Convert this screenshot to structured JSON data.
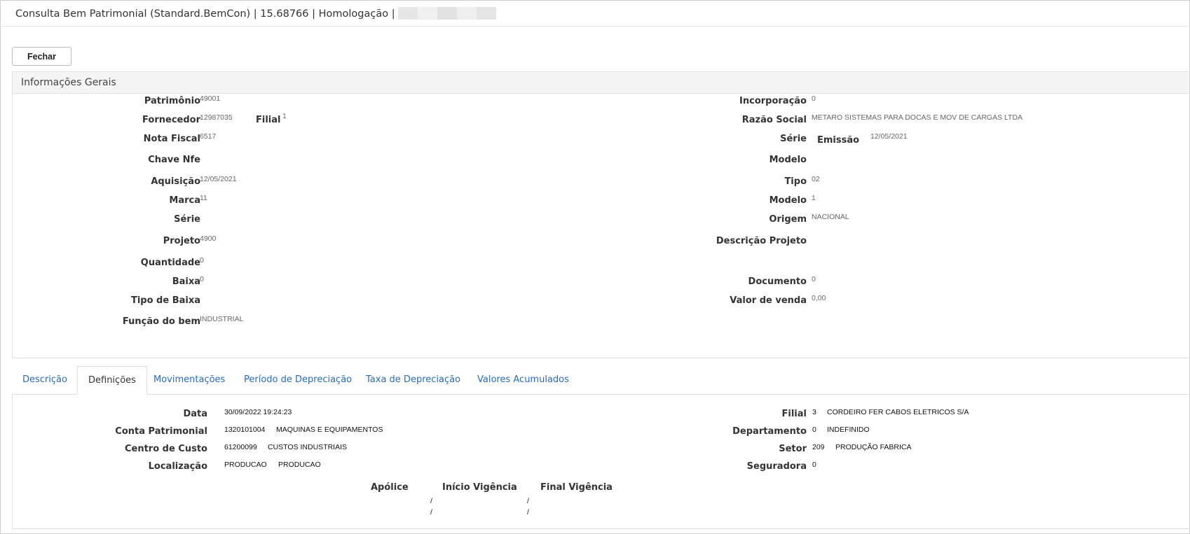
{
  "window": {
    "title": "Consulta Bem Patrimonial (Standard.BemCon) | 15.68766 | Homologação |"
  },
  "toolbar": {
    "close_label": "Fechar"
  },
  "general_panel": {
    "title": "Informações Gerais",
    "left": [
      {
        "label": "Patrimônio",
        "value": "49001"
      },
      {
        "label": "Fornecedor",
        "value": "12987035",
        "extra_label": "Filial",
        "extra_value": "1"
      },
      {
        "label": "Nota Fiscal",
        "value": "6517"
      },
      {
        "label": "Chave Nfe",
        "value": ""
      },
      {
        "label": "Aquisição",
        "value": "12/05/2021"
      },
      {
        "label": "Marca",
        "value": "11"
      },
      {
        "label": "Série",
        "value": ""
      },
      {
        "label": "Projeto",
        "value": "4900"
      },
      {
        "label": "Quantidade",
        "value": "0"
      },
      {
        "label": "Baixa",
        "value": "0"
      },
      {
        "label": "Tipo de Baixa",
        "value": ""
      },
      {
        "label": "Função do bem",
        "value": "INDUSTRIAL"
      }
    ],
    "right": [
      {
        "label": "Incorporação",
        "value": "0"
      },
      {
        "label": "Razão Social",
        "value": "METARO SISTEMAS PARA DOCAS E MOV DE CARGAS LTDA"
      },
      {
        "label": "Série",
        "value": "",
        "extra_label": "Emissão",
        "extra_value": "12/05/2021"
      },
      {
        "label": "Modelo",
        "value": ""
      },
      {
        "label": "Tipo",
        "value": "02"
      },
      {
        "label": "Modelo",
        "value": "1"
      },
      {
        "label": "Origem",
        "value": "NACIONAL"
      },
      {
        "label": "Descrição Projeto",
        "value": ""
      },
      {
        "label": "Documento",
        "value": "0"
      },
      {
        "label": "Valor de venda",
        "value": "0,00"
      }
    ]
  },
  "tabs": [
    {
      "label": "Descrição",
      "active": false
    },
    {
      "label": "Definições",
      "active": true
    },
    {
      "label": "Movimentações",
      "active": false
    },
    {
      "label": "Período de Depreciação",
      "active": false
    },
    {
      "label": "Taxa de Depreciação",
      "active": false
    },
    {
      "label": "Valores Acumulados",
      "active": false
    }
  ],
  "definicoes": {
    "left": [
      {
        "label": "Data",
        "code": "30/09/2022 19:24:23",
        "desc": ""
      },
      {
        "label": "Conta Patrimonial",
        "code": "1320101004",
        "desc": "MAQUINAS E EQUIPAMENTOS"
      },
      {
        "label": "Centro de Custo",
        "code": "61200099",
        "desc": "CUSTOS INDUSTRIAIS"
      },
      {
        "label": "Localização",
        "code": "PRODUCAO",
        "desc": "PRODUCAO"
      }
    ],
    "right": [
      {
        "label": "Filial",
        "code": "3",
        "desc": "CORDEIRO FER CABOS ELETRICOS S/A"
      },
      {
        "label": "Departamento",
        "code": "0",
        "desc": "INDEFINIDO"
      },
      {
        "label": "Setor",
        "code": "209",
        "desc": "PRODUÇÃO FABRICA"
      },
      {
        "label": "Seguradora",
        "code": "0",
        "desc": ""
      }
    ],
    "insurance_table": {
      "headers": [
        "Apólice",
        "Início Vigência",
        "Final Vigência"
      ],
      "rows": [
        [
          "",
          "/",
          "/"
        ],
        [
          "",
          "/",
          "/"
        ]
      ]
    }
  }
}
